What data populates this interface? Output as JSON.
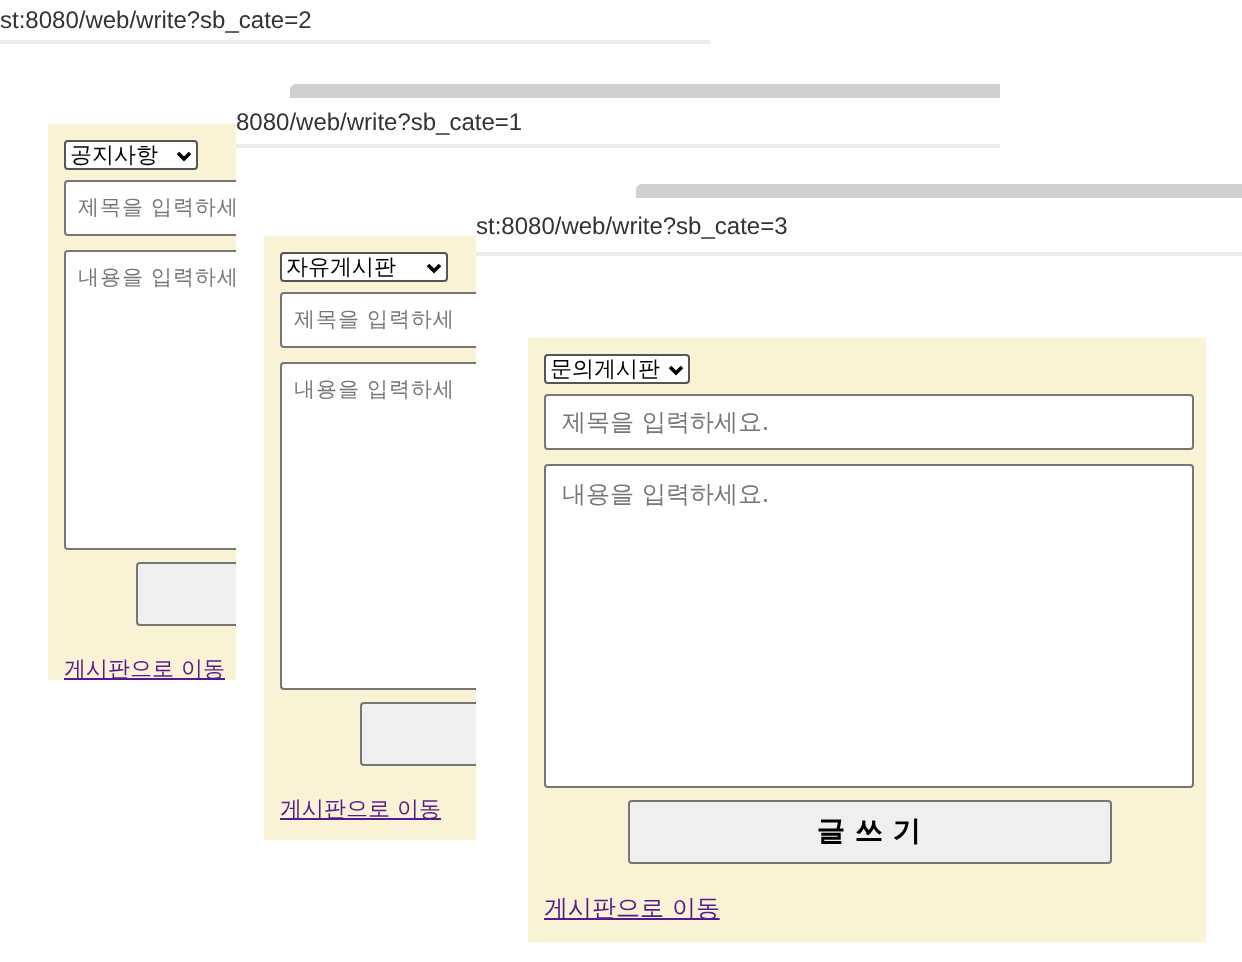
{
  "windows": [
    {
      "address": "st:8080/web/write?sb_cate=2",
      "tab_strip": false,
      "form": {
        "category": "공지사항",
        "title_placeholder": "제목을 입력하세",
        "content_placeholder": "내용을 입력하세",
        "link": "게시판으로 이동"
      }
    },
    {
      "address": "8080/web/write?sb_cate=1",
      "tab_strip": true,
      "form": {
        "category": "자유게시판",
        "title_placeholder": "제목을 입력하세",
        "content_placeholder": "내용을 입력하세",
        "link": "게시판으로 이동"
      }
    },
    {
      "address": "st:8080/web/write?sb_cate=3",
      "tab_strip": true,
      "form": {
        "category": "문의게시판",
        "title_placeholder": "제목을 입력하세요.",
        "content_placeholder": "내용을 입력하세요.",
        "submit_label": "글 쓰 기",
        "link": "게시판으로 이동"
      }
    }
  ]
}
